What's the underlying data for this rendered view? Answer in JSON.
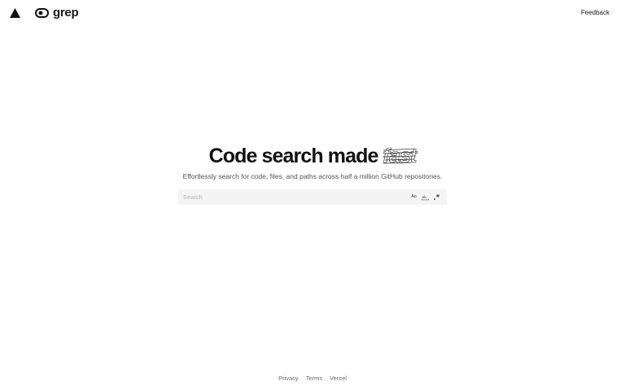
{
  "header": {
    "brand": "grep",
    "feedback_label": "Feedback"
  },
  "hero": {
    "title_prefix": "Code search made",
    "title_emphasis": "fast",
    "subtitle": "Effortlessly search for code, files, and paths across half a million GitHub repositories."
  },
  "search": {
    "placeholder": "Search",
    "value": "",
    "options": [
      {
        "name": "match-case",
        "glyph": "Aa"
      },
      {
        "name": "match-whole-word",
        "glyph": "ab"
      },
      {
        "name": "use-regex",
        "glyph": ".*"
      }
    ]
  },
  "footer": {
    "links": [
      "Privacy",
      "Terms",
      "Vercel"
    ]
  },
  "colors": {
    "text": "#171717",
    "muted": "#525252",
    "search_bg": "#f4f4f4",
    "footer_link": "#6b6b6b"
  }
}
